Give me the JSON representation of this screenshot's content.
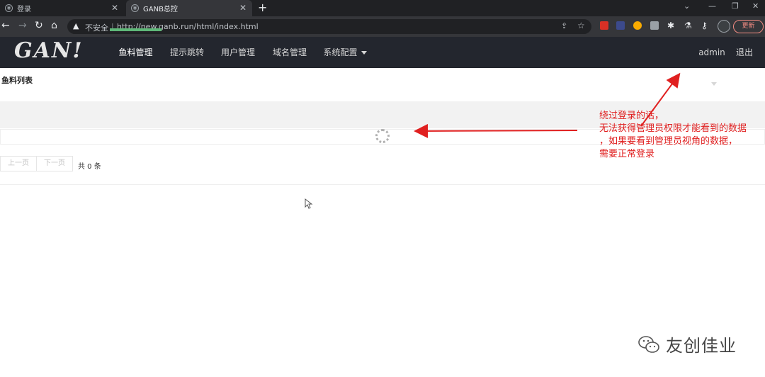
{
  "browser": {
    "tabs": [
      {
        "title": "登录",
        "active": false
      },
      {
        "title": "GANB总控",
        "active": true
      }
    ],
    "address": {
      "security": "不安全",
      "url": "http://new.ganb.run/html/index.html"
    },
    "update_label": "更新"
  },
  "app": {
    "logo": "GAN!",
    "nav": [
      {
        "label": "鱼料管理",
        "active": true
      },
      {
        "label": "提示跳转",
        "active": false
      },
      {
        "label": "用户管理",
        "active": false
      },
      {
        "label": "域名管理",
        "active": false
      },
      {
        "label": "系统配置",
        "active": false,
        "has_dropdown": true
      }
    ],
    "user": "admin",
    "logout": "退出"
  },
  "content": {
    "title": "鱼料列表",
    "pager": {
      "prev": "上一页",
      "next": "下一页",
      "total": "共 0 条"
    }
  },
  "annotation": {
    "lines": [
      "绕过登录的话，",
      "无法获得管理员权限才能看到的数据",
      "，如果要看到管理员视角的数据，",
      "需要正常登录"
    ],
    "color": "#e02020"
  },
  "watermark": {
    "text": "友创佳业"
  },
  "colors": {
    "navbar": "#23262e",
    "accent": "#5fb878"
  }
}
